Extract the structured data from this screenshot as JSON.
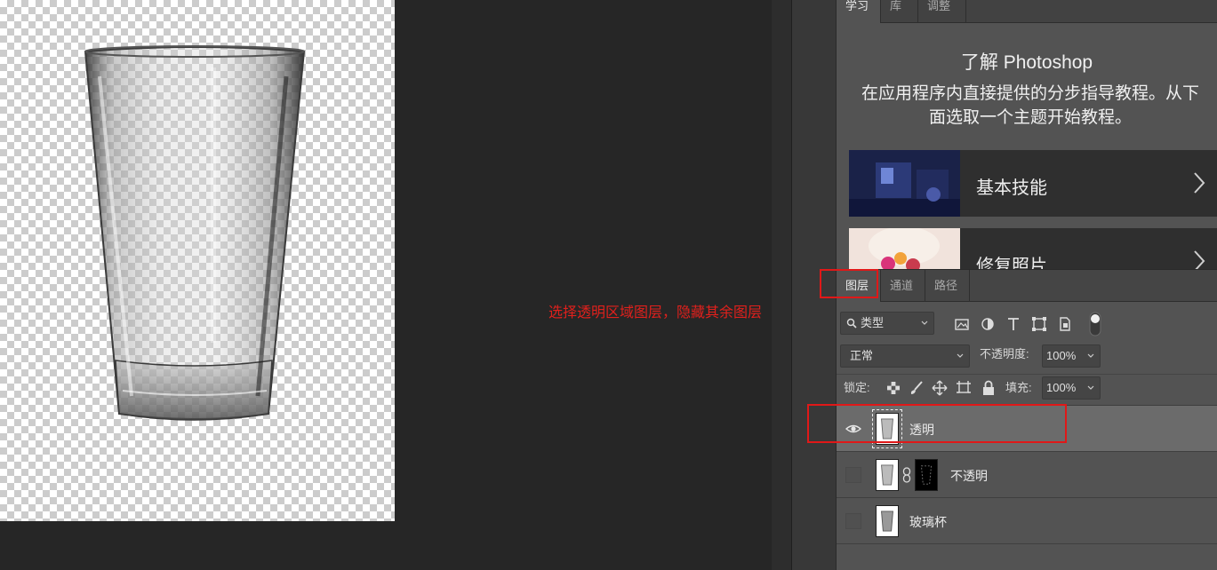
{
  "canvas": {
    "annotation": "选择透明区域图层，隐藏其余图层"
  },
  "learn_panel": {
    "tabs": [
      "学习",
      "库",
      "调整"
    ],
    "title": "了解 Photoshop",
    "description": "在应用程序内直接提供的分步指导教程。从下面选取一个主题开始教程。",
    "cards": [
      {
        "label": "基本技能",
        "icon": "chevron-right-icon"
      },
      {
        "label": "修复照片",
        "icon": "chevron-right-icon"
      }
    ]
  },
  "layers_panel": {
    "tabs": [
      "图层",
      "通道",
      "路径"
    ],
    "filter": {
      "label": "类型",
      "icon": "search-icon"
    },
    "filter_icons": [
      "image-filter-icon",
      "adjustment-filter-icon",
      "text-filter-icon",
      "shape-filter-icon",
      "smart-object-filter-icon",
      "filter-toggle-icon"
    ],
    "blend_mode": "正常",
    "opacity_label": "不透明度:",
    "opacity_value": "100%",
    "lock_label": "锁定:",
    "lock_icons": [
      "lock-transparent-icon",
      "lock-paint-icon",
      "lock-position-icon",
      "lock-artboard-icon",
      "lock-all-icon"
    ],
    "fill_label": "填充:",
    "fill_value": "100%",
    "layers": [
      {
        "name": "透明",
        "visible": true,
        "selected": true,
        "mask": false
      },
      {
        "name": "不透明",
        "visible": false,
        "selected": false,
        "mask": true
      },
      {
        "name": "玻璃杯",
        "visible": false,
        "selected": false,
        "mask": false
      }
    ]
  },
  "colors": {
    "annotation_red": "#e0201c",
    "panel_bg": "#535353",
    "selected_layer": "#6b6b6b"
  }
}
